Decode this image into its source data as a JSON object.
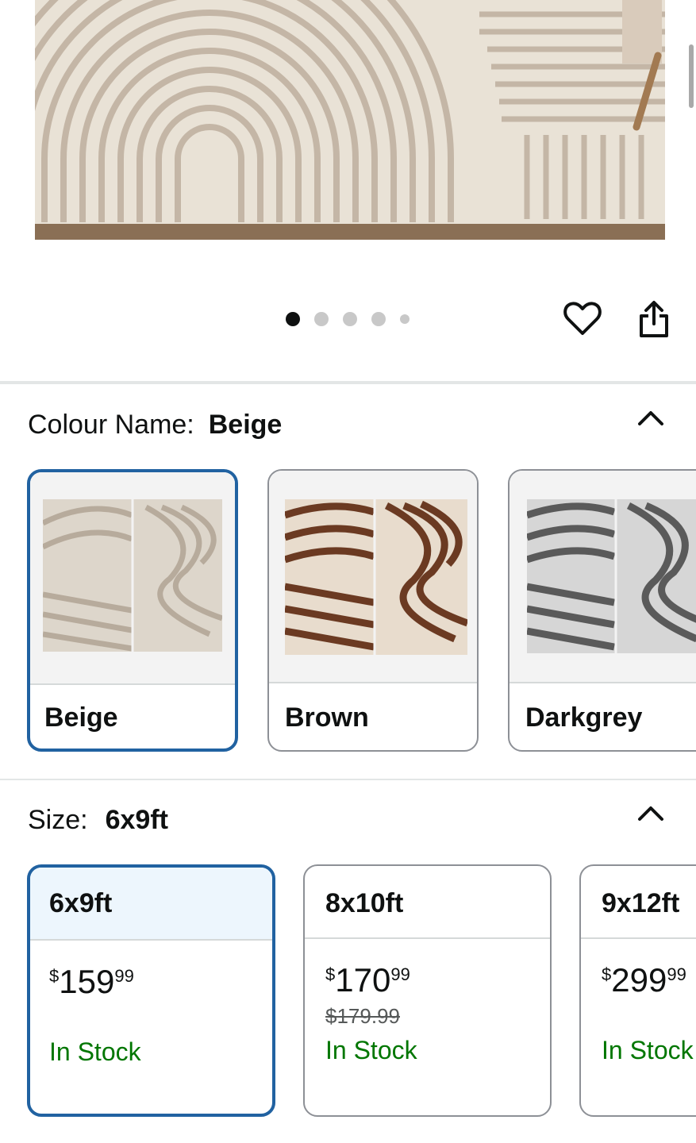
{
  "carousel": {
    "dot_count": 5,
    "active_index": 0
  },
  "colour": {
    "label": "Colour Name:",
    "selected": "Beige",
    "options": [
      {
        "name": "Beige",
        "selected": true,
        "bg": "#d6d0c6",
        "stripe": "#b9aea1"
      },
      {
        "name": "Brown",
        "selected": false,
        "bg": "#e8ddd0",
        "stripe": "#6b3a22"
      },
      {
        "name": "Darkgrey",
        "selected": false,
        "bg": "#d8d8d8",
        "stripe": "#5a5a5a"
      }
    ]
  },
  "size": {
    "label": "Size:",
    "selected": "6x9ft",
    "options": [
      {
        "name": "6x9ft",
        "selected": true,
        "currency": "$",
        "price_whole": "159",
        "price_fraction": "99",
        "was_price": "",
        "stock": "In Stock"
      },
      {
        "name": "8x10ft",
        "selected": false,
        "currency": "$",
        "price_whole": "170",
        "price_fraction": "99",
        "was_price": "$179.99",
        "stock": "In Stock"
      },
      {
        "name": "9x12ft",
        "selected": false,
        "currency": "$",
        "price_whole": "299",
        "price_fraction": "99",
        "was_price": "",
        "stock": "In Stock"
      }
    ]
  },
  "colors": {
    "selected_border": "#2162a1",
    "in_stock": "#007600",
    "selected_bg": "#edf6fd"
  },
  "icons": {
    "wishlist": "heart-icon",
    "share": "share-icon",
    "collapse": "chevron-up-icon"
  }
}
